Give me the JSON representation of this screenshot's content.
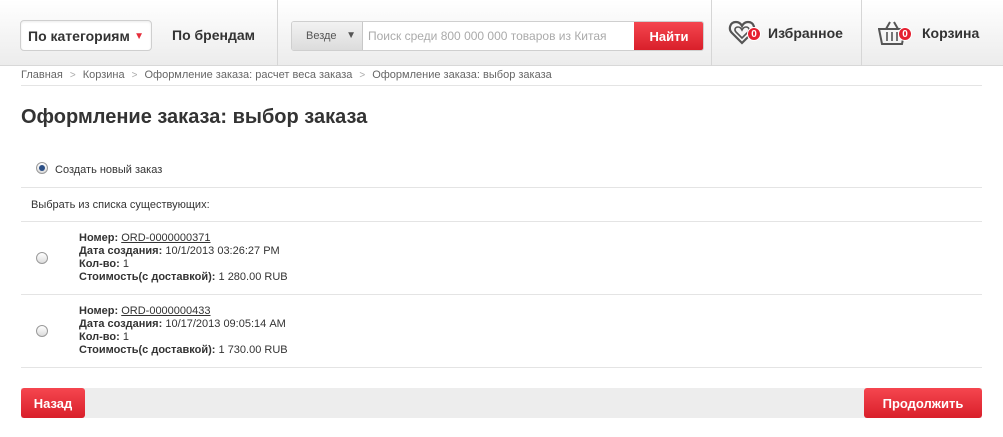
{
  "header": {
    "category_label": "По категориям",
    "brands_label": "По брендам",
    "search_scope": "Везде",
    "search_placeholder": "Поиск среди 800 000 000 товаров из Китая",
    "search_button": "Найти",
    "favorites_label": "Избранное",
    "favorites_count": "0",
    "cart_label": "Корзина",
    "cart_count": "0",
    "accent_color": "#e52d3b"
  },
  "breadcrumb": [
    "Главная",
    "Корзина",
    "Оформление заказа: расчет веса заказа",
    "Оформление заказа: выбор заказа"
  ],
  "page_title": "Оформление заказа: выбор заказа",
  "new_order_label": "Создать новый заказ",
  "new_order_selected": true,
  "existing_label": "Выбрать из списка существующих:",
  "orders": [
    {
      "number_label": "Номер:",
      "number": "ORD-0000000371",
      "date_label": "Дата создания:",
      "date": "10/1/2013 03:26:27 PM",
      "qty_label": "Кол-во:",
      "qty": "1",
      "cost_label": "Стоимость(с доставкой):",
      "cost": "1 280.00 RUB"
    },
    {
      "number_label": "Номер:",
      "number": "ORD-0000000433",
      "date_label": "Дата создания:",
      "date": "10/17/2013 09:05:14 AM",
      "qty_label": "Кол-во:",
      "qty": "1",
      "cost_label": "Стоимость(с доставкой):",
      "cost": "1 730.00 RUB"
    }
  ],
  "footer": {
    "back_label": "Назад",
    "continue_label": "Продолжить"
  }
}
